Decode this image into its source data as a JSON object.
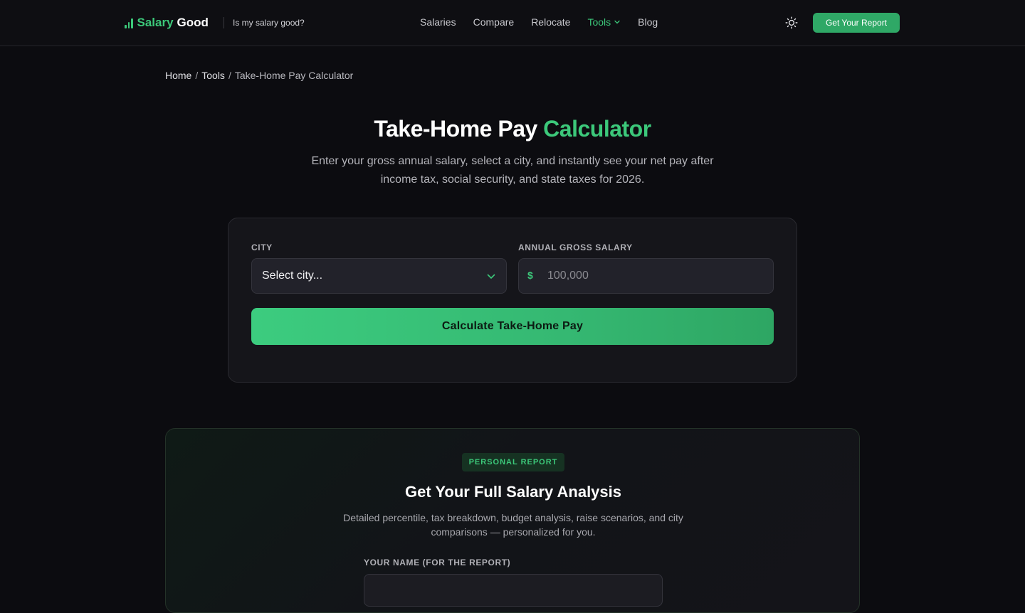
{
  "header": {
    "logo_word1": "Salary",
    "logo_word2": "Good",
    "tagline": "Is my salary good?",
    "nav": [
      {
        "label": "Salaries"
      },
      {
        "label": "Compare"
      },
      {
        "label": "Relocate"
      },
      {
        "label": "Tools",
        "active": true
      },
      {
        "label": "Blog"
      }
    ],
    "cta_label": "Get Your Report"
  },
  "breadcrumb": {
    "home": "Home",
    "tools": "Tools",
    "current": "Take-Home Pay Calculator",
    "separator": "/"
  },
  "hero": {
    "title_main": "Take-Home Pay",
    "title_accent": "Calculator",
    "subtitle": "Enter your gross annual salary, select a city, and instantly see your net pay after income tax, social security, and state taxes for 2026."
  },
  "calculator": {
    "city_label": "CITY",
    "city_value": "Select city...",
    "salary_label": "ANNUAL GROSS SALARY",
    "currency_symbol": "$",
    "salary_placeholder": "100,000",
    "submit_label": "Calculate Take-Home Pay"
  },
  "report": {
    "badge": "PERSONAL REPORT",
    "title": "Get Your Full Salary Analysis",
    "description": "Detailed percentile, tax breakdown, budget analysis, raise scenarios, and city comparisons — personalized for you.",
    "name_label": "YOUR NAME (FOR THE REPORT)"
  },
  "colors": {
    "accent": "#3cc87a",
    "background": "#0c0c10",
    "card": "#15151a"
  },
  "icons": {
    "logo": "bar-chart-icon",
    "theme": "sun-icon",
    "dropdown": "chevron-down-icon"
  }
}
